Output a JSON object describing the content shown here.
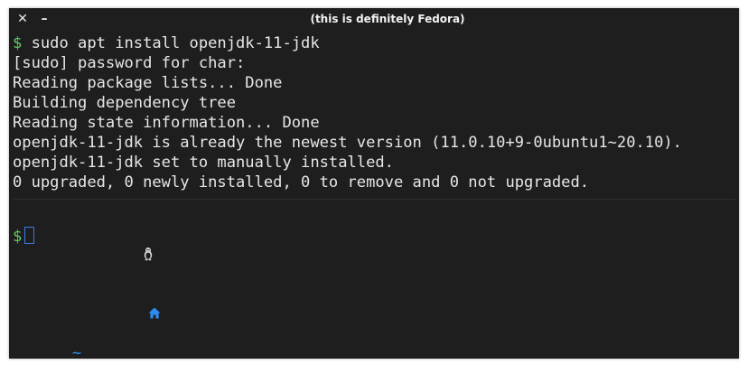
{
  "window": {
    "title": "(this is definitely Fedora)",
    "close_glyph": "✕",
    "minimize_glyph": "–"
  },
  "terminal": {
    "prompt_symbol": "$",
    "command": " sudo apt install openjdk-11-jdk",
    "output": [
      "[sudo] password for char:",
      "Reading package lists... Done",
      "Building dependency tree",
      "Reading state information... Done",
      "openjdk-11-jdk is already the newest version (11.0.10+9-0ubuntu1~20.10).",
      "openjdk-11-jdk set to manually installed.",
      "0 upgraded, 0 newly installed, 0 to remove and 0 not upgraded."
    ],
    "status_prompt": {
      "os_icon": "linux-penguin-icon",
      "home_icon": "home-icon",
      "path": "~"
    }
  },
  "colors": {
    "background": "#1e1e1e",
    "foreground": "#e6e6e6",
    "prompt_green": "#5fcf5f",
    "path_blue": "#2b8df0",
    "cursor_blue": "#3a7bf0"
  }
}
